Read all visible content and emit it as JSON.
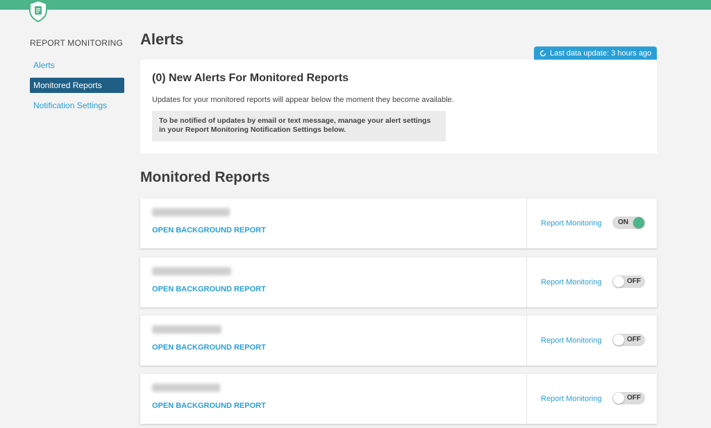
{
  "sidebar": {
    "heading": "REPORT MONITORING",
    "items": [
      {
        "label": "Alerts",
        "active": false
      },
      {
        "label": "Monitored Reports",
        "active": true
      },
      {
        "label": "Notification Settings",
        "active": false
      }
    ]
  },
  "page": {
    "title": "Alerts"
  },
  "update_badge": {
    "text": "Last data update: 3 hours ago"
  },
  "alerts": {
    "heading": "(0) New Alerts For Monitored Reports",
    "description": "Updates for your monitored reports will appear below the moment they become available.",
    "note_line1": "To be notified of updates by email or text message, manage your alert settings",
    "note_line2": "in your Report Monitoring Notification Settings below."
  },
  "monitored": {
    "title": "Monitored Reports",
    "reports": [
      {
        "open_label": "OPEN BACKGROUND REPORT",
        "monitor_label": "Report Monitoring",
        "toggle": "ON"
      },
      {
        "open_label": "OPEN BACKGROUND REPORT",
        "monitor_label": "Report Monitoring",
        "toggle": "OFF"
      },
      {
        "open_label": "OPEN BACKGROUND REPORT",
        "monitor_label": "Report Monitoring",
        "toggle": "OFF"
      },
      {
        "open_label": "OPEN BACKGROUND REPORT",
        "monitor_label": "Report Monitoring",
        "toggle": "OFF"
      }
    ]
  },
  "colors": {
    "brand_green": "#4cb58a",
    "accent_blue": "#2a9fd6",
    "active_nav": "#1f5f86"
  },
  "icons": {
    "logo": "shield-document-icon",
    "sync": "sync-icon"
  }
}
